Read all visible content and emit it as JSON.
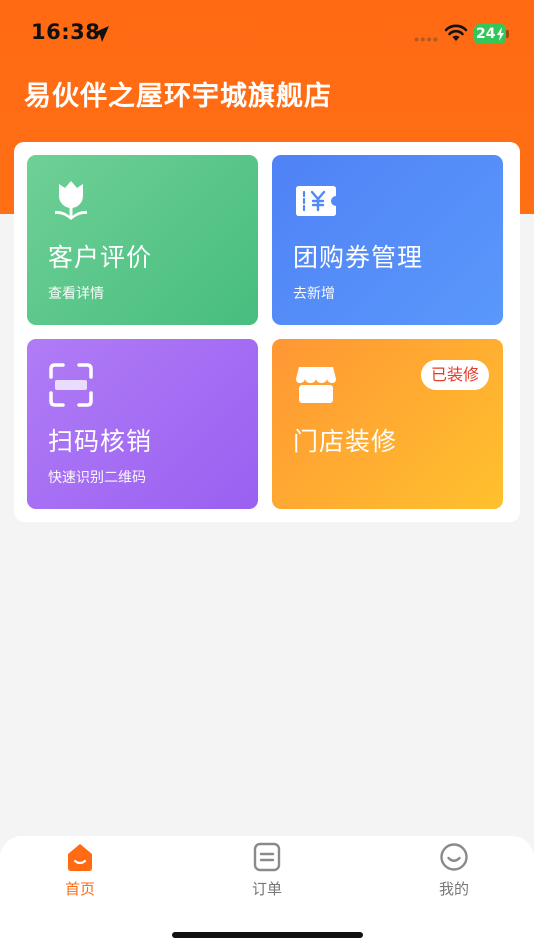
{
  "status_bar": {
    "time": "16:38",
    "battery_level": "24",
    "icons": [
      "location-arrow-icon",
      "signal-dots-icon",
      "wifi-icon",
      "battery-charging-icon"
    ]
  },
  "header": {
    "store_name": "易伙伴之屋环宇城旗舰店",
    "background_color": "#ff6a13"
  },
  "cards": [
    {
      "title": "客户评价",
      "subtitle": "查看详情",
      "icon": "tulip-icon",
      "color": "#5cc78a"
    },
    {
      "title": "团购券管理",
      "subtitle": "去新增",
      "icon": "yen-ticket-icon",
      "color": "#5289f7"
    },
    {
      "title": "扫码核销",
      "subtitle": "快速识别二维码",
      "icon": "scan-icon",
      "color": "#a56df3"
    },
    {
      "title": "门店装修",
      "subtitle": "",
      "badge": "已装修",
      "icon": "storefront-icon",
      "color": "#ffab32"
    }
  ],
  "tabbar": {
    "items": [
      {
        "label": "首页",
        "icon": "home-icon",
        "active": true
      },
      {
        "label": "订单",
        "icon": "order-icon",
        "active": false
      },
      {
        "label": "我的",
        "icon": "smile-face-icon",
        "active": false
      }
    ],
    "active_color": "#ff6a13"
  }
}
